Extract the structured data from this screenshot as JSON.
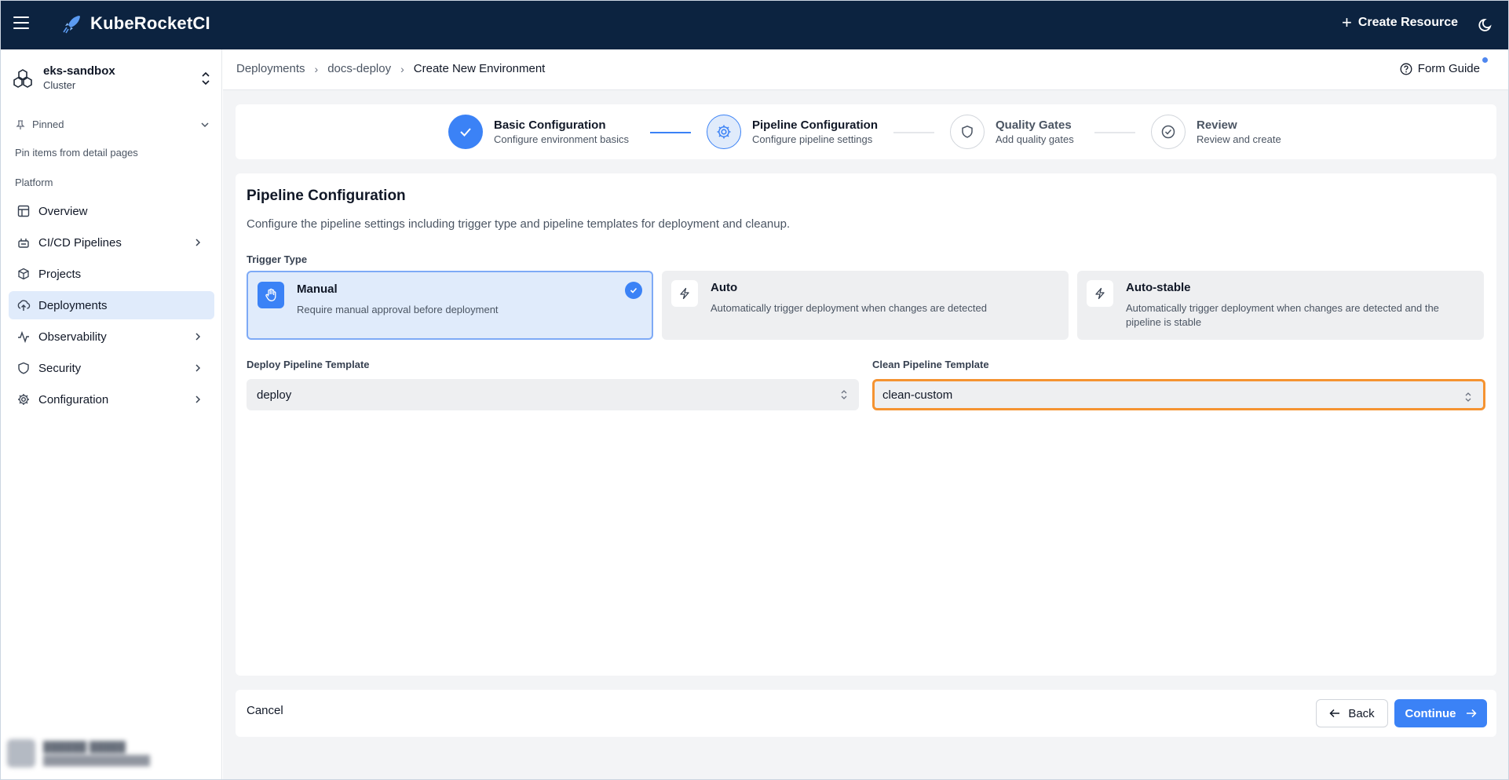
{
  "app": {
    "name": "KubeRocketCI",
    "create_resource": "Create Resource"
  },
  "cluster": {
    "name": "eks-sandbox",
    "type": "Cluster"
  },
  "sidebar": {
    "pinned_label": "Pinned",
    "pinned_hint": "Pin items from detail pages",
    "section": "Platform",
    "items": [
      {
        "label": "Overview",
        "icon": "layout-icon",
        "expandable": false,
        "active": false
      },
      {
        "label": "CI/CD Pipelines",
        "icon": "pipelines-icon",
        "expandable": true,
        "active": false
      },
      {
        "label": "Projects",
        "icon": "box-icon",
        "expandable": false,
        "active": false
      },
      {
        "label": "Deployments",
        "icon": "cloud-upload-icon",
        "expandable": false,
        "active": true
      },
      {
        "label": "Observability",
        "icon": "activity-icon",
        "expandable": true,
        "active": false
      },
      {
        "label": "Security",
        "icon": "shield-icon",
        "expandable": true,
        "active": false
      },
      {
        "label": "Configuration",
        "icon": "gear-icon",
        "expandable": true,
        "active": false
      }
    ]
  },
  "breadcrumb": {
    "items": [
      "Deployments",
      "docs-deploy"
    ],
    "current": "Create New Environment"
  },
  "form_guide": "Form Guide",
  "steps": [
    {
      "title": "Basic Configuration",
      "desc": "Configure environment basics",
      "state": "done"
    },
    {
      "title": "Pipeline Configuration",
      "desc": "Configure pipeline settings",
      "state": "current"
    },
    {
      "title": "Quality Gates",
      "desc": "Add quality gates",
      "state": "todo"
    },
    {
      "title": "Review",
      "desc": "Review and create",
      "state": "todo"
    }
  ],
  "form": {
    "title": "Pipeline Configuration",
    "description": "Configure the pipeline settings including trigger type and pipeline templates for deployment and cleanup.",
    "trigger_label": "Trigger Type",
    "trigger_options": [
      {
        "title": "Manual",
        "desc": "Require manual approval before deployment",
        "icon": "hand-icon",
        "selected": true
      },
      {
        "title": "Auto",
        "desc": "Automatically trigger deployment when changes are detected",
        "icon": "lightning-icon",
        "selected": false
      },
      {
        "title": "Auto-stable",
        "desc": "Automatically trigger deployment when changes are detected and the pipeline is stable",
        "icon": "lightning-icon",
        "selected": false
      }
    ],
    "deploy_template": {
      "label": "Deploy Pipeline Template",
      "value": "deploy"
    },
    "clean_template": {
      "label": "Clean Pipeline Template",
      "value": "clean-custom"
    }
  },
  "footer": {
    "cancel": "Cancel",
    "back": "Back",
    "continue": "Continue"
  },
  "colors": {
    "topbar": "#0c2340",
    "accent": "#3b82f6",
    "focus_ring": "#f59331",
    "active_nav": "#e0ebfb"
  }
}
